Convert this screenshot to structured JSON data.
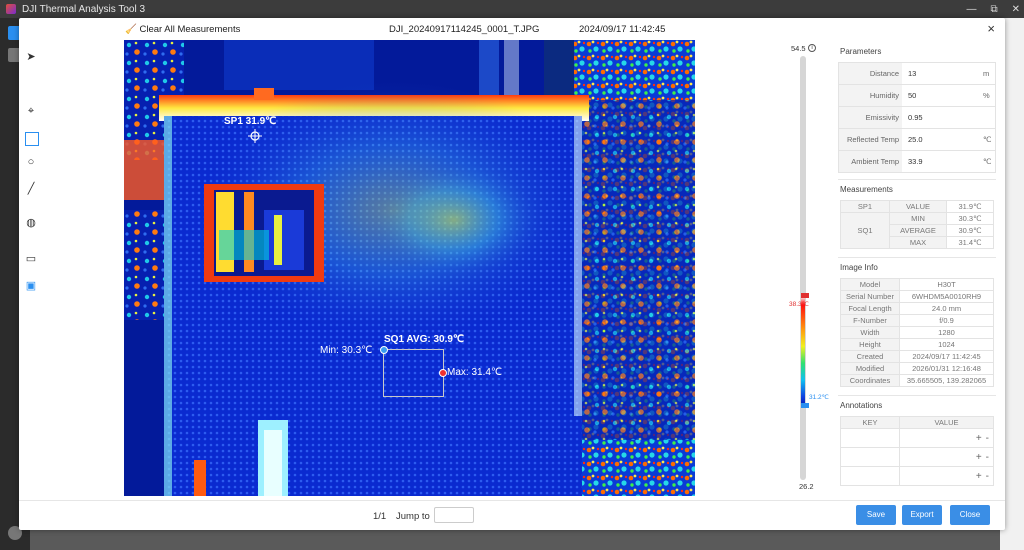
{
  "app": {
    "title": "DJI Thermal Analysis Tool 3",
    "window_controls": [
      "—",
      "⧉",
      "✕"
    ]
  },
  "header": {
    "clear_label": "Clear All Measurements",
    "filename": "DJI_20240917114245_0001_T.JPG",
    "datetime": "2024/09/17 11:42:45",
    "close_glyph": "×"
  },
  "overlays": {
    "sp1_label": "SP1 31.9℃",
    "sq1_label": "SQ1 AVG: 30.9℃",
    "min_label": "Min: 30.3℃",
    "max_label": "Max: 31.4℃"
  },
  "scale": {
    "max": "54.5",
    "min": "26.2",
    "high_marker": "38.3℃",
    "low_marker": "31.2℃"
  },
  "parameters": {
    "title": "Parameters",
    "rows": [
      {
        "label": "Distance",
        "value": "13",
        "unit": "m"
      },
      {
        "label": "Humidity",
        "value": "50",
        "unit": "%"
      },
      {
        "label": "Emissivity",
        "value": "0.95",
        "unit": ""
      },
      {
        "label": "Reflected Temp",
        "value": "25.0",
        "unit": "℃"
      },
      {
        "label": "Ambient Temp",
        "value": "33.9",
        "unit": "℃"
      }
    ]
  },
  "measurements": {
    "title": "Measurements",
    "sp1": {
      "name": "SP1",
      "key": "VALUE",
      "value": "31.9℃"
    },
    "sq1": {
      "name": "SQ1",
      "min_key": "MIN",
      "min_value": "30.3℃",
      "avg_key": "AVERAGE",
      "avg_value": "30.9℃",
      "max_key": "MAX",
      "max_value": "31.4℃"
    }
  },
  "image_info": {
    "title": "Image Info",
    "rows": [
      {
        "label": "Model",
        "value": "H30T"
      },
      {
        "label": "Serial Number",
        "value": "6WHDM5A0010RH9"
      },
      {
        "label": "Focal Length",
        "value": "24.0 mm"
      },
      {
        "label": "F-Number",
        "value": "f/0.9"
      },
      {
        "label": "Width",
        "value": "1280"
      },
      {
        "label": "Height",
        "value": "1024"
      },
      {
        "label": "Created",
        "value": "2024/09/17 11:42:45"
      },
      {
        "label": "Modified",
        "value": "2026/01/31 12:16:48"
      },
      {
        "label": "Coordinates",
        "value": "35.665505, 139.282065"
      }
    ]
  },
  "annotations": {
    "title": "Annotations",
    "key_header": "KEY",
    "value_header": "VALUE",
    "add": "+",
    "remove": "-"
  },
  "footer": {
    "page_info": "1/1",
    "jump_label": "Jump to",
    "save": "Save",
    "export": "Export",
    "close": "Close"
  }
}
